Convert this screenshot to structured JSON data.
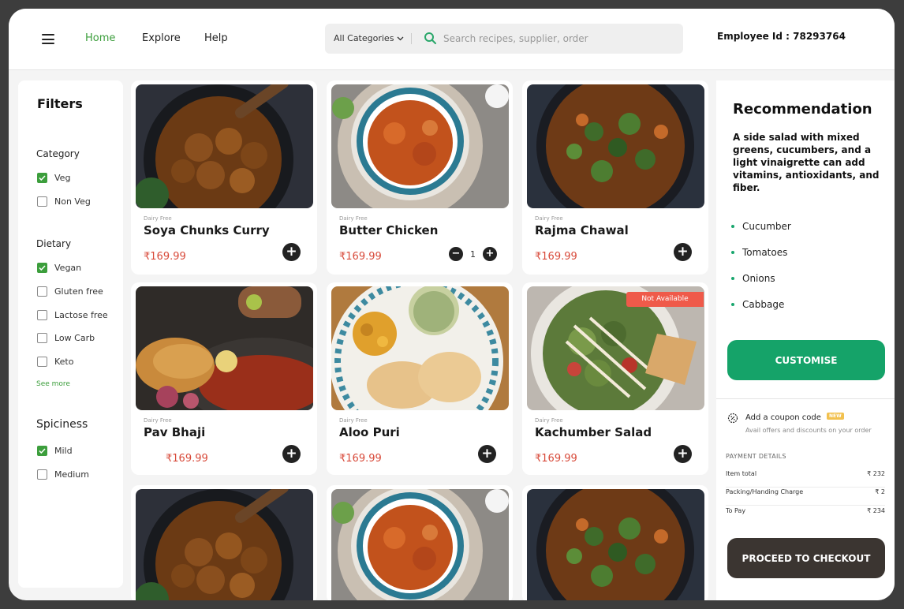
{
  "nav": {
    "items": [
      {
        "label": "Home",
        "active": true
      },
      {
        "label": "Explore",
        "active": false
      },
      {
        "label": "Help",
        "active": false
      }
    ]
  },
  "search": {
    "category_label": "All Categories",
    "placeholder": "Search recipes, supplier, order",
    "value": ""
  },
  "employee": {
    "label": "Employee Id : 78293764"
  },
  "filters": {
    "title": "Filters",
    "category": {
      "title": "Category",
      "options": [
        {
          "label": "Veg",
          "checked": true
        },
        {
          "label": "Non Veg",
          "checked": false
        }
      ]
    },
    "dietary": {
      "title": "Dietary",
      "options": [
        {
          "label": "Vegan",
          "checked": true
        },
        {
          "label": "Gluten free",
          "checked": false
        },
        {
          "label": "Lactose free",
          "checked": false
        },
        {
          "label": "Low Carb",
          "checked": false
        },
        {
          "label": "Keto",
          "checked": false
        }
      ],
      "see_more": "See more"
    },
    "spiciness": {
      "title": "Spiciness",
      "options": [
        {
          "label": "Mild",
          "checked": true
        },
        {
          "label": "Medium",
          "checked": false
        }
      ]
    }
  },
  "products": [
    {
      "tag": "Dairy Free",
      "name": "Soya Chunks Curry",
      "price": "₹169.99",
      "image": "curry-pan"
    },
    {
      "tag": "Dairy Free",
      "name": "Butter Chicken",
      "price": "₹169.99",
      "image": "butter-chicken",
      "quantity": "1"
    },
    {
      "tag": "Dairy Free",
      "name": "Rajma Chawal",
      "price": "₹169.99",
      "image": "herb-curry"
    },
    {
      "tag": "Dairy Free",
      "name": "Pav Bhaji",
      "price": "₹169.99",
      "image": "pav-bhaji"
    },
    {
      "tag": "Dairy Free",
      "name": "Aloo Puri",
      "price": "₹169.99",
      "image": "aloo-puri"
    },
    {
      "tag": "Dairy Free",
      "name": "Kachumber Salad",
      "price": "₹169.99",
      "image": "salad",
      "badge": "Not Available"
    },
    {
      "image": "curry-pan"
    },
    {
      "image": "butter-chicken"
    },
    {
      "image": "herb-curry"
    }
  ],
  "recommendation": {
    "title": "Recommendation",
    "text": "A side salad with mixed greens, cucumbers, and a light vinaigrette can add vitamins, antioxidants, and fiber.",
    "items": [
      "Cucumber",
      "Tomatoes",
      "Onions",
      "Cabbage"
    ],
    "customise_label": "CUSTOMISE"
  },
  "coupon": {
    "title": "Add a coupon code",
    "badge": "NEW",
    "subtitle": "Avail offers and discounts on your order"
  },
  "payment": {
    "title": "PAYMENT DETAILS",
    "rows": [
      {
        "label": "Item total",
        "value": "₹ 232"
      },
      {
        "label": "Packing/Handing Charge",
        "value": "₹ 2"
      },
      {
        "label": "To Pay",
        "value": "₹ 234"
      }
    ]
  },
  "checkout_label": "PROCEED TO CHECKOUT",
  "colors": {
    "accent": "#3c9e3c",
    "primary_button": "#15a369",
    "dark_button": "#3b3531",
    "price": "#d84a3a",
    "unavailable": "#ef5a4a"
  }
}
